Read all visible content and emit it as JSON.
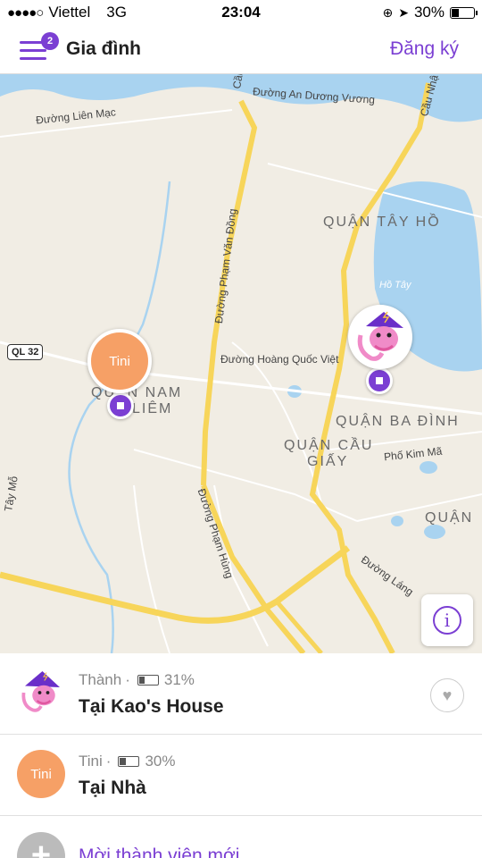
{
  "status_bar": {
    "signal": "●●●●○",
    "carrier": "Viettel",
    "network": "3G",
    "time": "23:04",
    "battery_text": "30%"
  },
  "header": {
    "title": "Gia đình",
    "badge_count": "2",
    "action_label": "Đăng ký",
    "accent_color": "#7b3fd3"
  },
  "map": {
    "labels": {
      "duong_lien_mac": "Đường Liên Mạc",
      "duong_an_duong_vuong": "Đường An Dương Vương",
      "cau_thang_long": "Cầu Th",
      "cau_nhat_tan": "Cầu Nhậ",
      "quan_tay_ho": "QUẬN TÂY HỒ",
      "ho_tay": "Hồ Tây",
      "duong_pham_van_dong": "Đường Phạm Văn Đồng",
      "duong_hoang_quoc_viet": "Đường Hoàng Quốc Việt",
      "quan_nam_tu_liem_1": "QUẬN NAM",
      "quan_nam_tu_liem_2": "LIÊM",
      "quan_ba_dinh": "QUẬN BA ĐÌNH",
      "quan_cau_giay_1": "QUẬN CẦU",
      "quan_cau_giay_2": "GIẤY",
      "pho_kim_ma": "Phố Kim Mã",
      "quan_partial": "QUẬN",
      "duong_pham_hung": "Đường Phạm Hùng",
      "duong_lang": "Đường Láng",
      "duong_tay_mo": "Tây Mỗ",
      "ql32": "QL 32"
    },
    "marker_tini_label": "Tini",
    "info_label": "i"
  },
  "members": [
    {
      "name": "Thành",
      "battery": "31%",
      "status": "Tại Kao's House",
      "avatar": "wizard-avatar"
    },
    {
      "name": "Tini",
      "battery": "30%",
      "status": "Tại Nhà",
      "avatar_text": "Tini"
    }
  ],
  "invite": {
    "icon": "+",
    "label": "Mời thành viên mới"
  }
}
